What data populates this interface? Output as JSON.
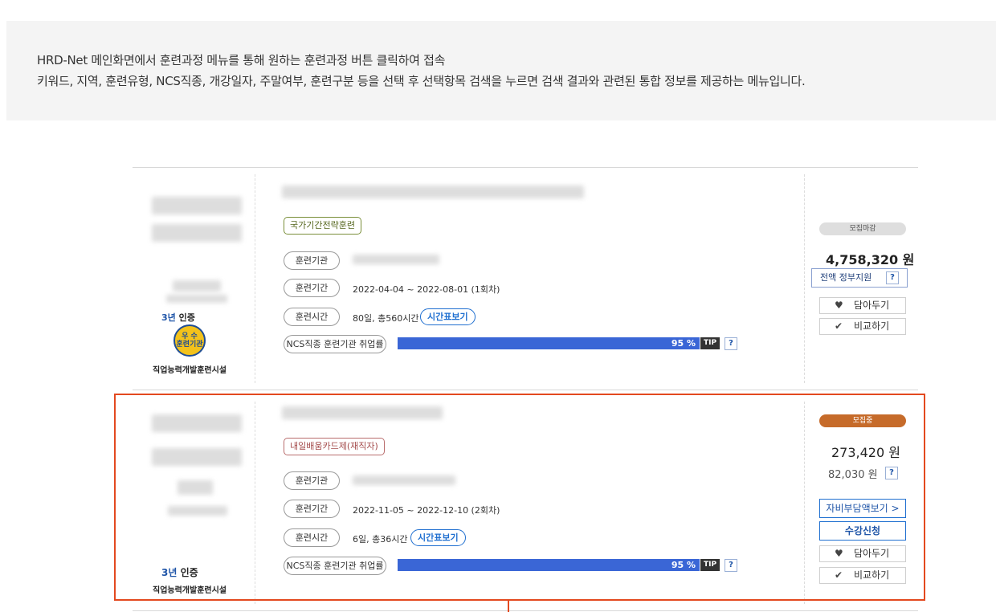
{
  "info": {
    "line1": "HRD-Net 메인화면에서 훈련과정 메뉴를 통해 원하는 훈련과정 버튼 클릭하여 접속",
    "line2": "키워드, 지역, 훈련유형, NCS직종, 개강일자, 주말여부, 훈련구분 등을 선택 후 선택항목 검색을 누르면 검색 결과와 관련된 통합 정보를 제공하는 메뉴입니다."
  },
  "labels": {
    "institution": "훈련기관",
    "period": "훈련기간",
    "hours": "훈련시간",
    "ncs_rate": "NCS직종 훈련기관 취업률",
    "timetable": "시간표보기",
    "tip": "TIP",
    "q": "?",
    "wishlist": "담아두기",
    "compare": "비교하기",
    "heart_icon": "♥",
    "check_icon": "✔"
  },
  "courses": [
    {
      "tag": "국가기간전략훈련",
      "period": "2022-04-04 ~ 2022-08-01 (1회차)",
      "hours": "80일, 총560시간",
      "rate": 95,
      "rate_label": "95 %",
      "cert_prefix": "3년",
      "cert_suffix": " 인증",
      "badge_line1": "우 수",
      "badge_line2": "훈련기관",
      "org_type": "직업능력개발훈련시설",
      "status": "모집마감",
      "price": "4,758,320 원",
      "support": "전액 정부지원"
    },
    {
      "tag": "내일배움카드제(재직자)",
      "period": "2022-11-05 ~ 2022-12-10 (2회차)",
      "hours": "6일, 총36시간",
      "rate": 95,
      "rate_label": "95 %",
      "cert_prefix": "3년",
      "cert_suffix": " 인증",
      "org_type": "직업능력개발훈련시설",
      "status": "모집중",
      "price": "273,420 원",
      "subprice": "82,030 원",
      "copay_button": "자비부담액보기 >",
      "apply_button": "수강신청"
    }
  ],
  "colors": {
    "accent_blue": "#3a66d6",
    "highlight": "#e3491f",
    "status_open": "#c66b2a",
    "status_closed": "#dedede"
  }
}
